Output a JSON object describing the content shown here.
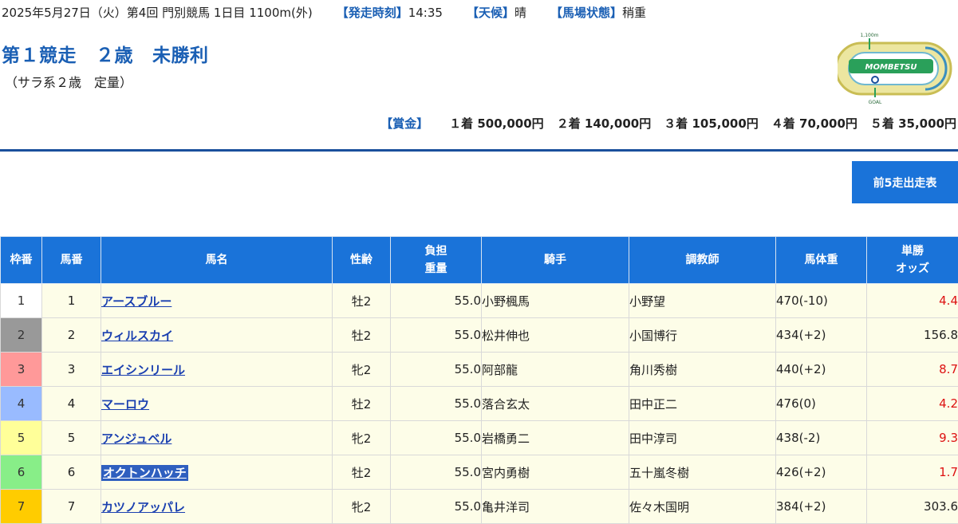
{
  "header": {
    "date_info": "2025年5月27日（火）第4回 門別競馬 1日目 1100m(外)",
    "start_time_label": "【発走時刻】",
    "start_time": "14:35",
    "weather_label": "【天候】",
    "weather": "晴",
    "track_label": "【馬場状態】",
    "track": "稍重"
  },
  "race": {
    "number": "第１競走",
    "age": "２歳",
    "class": "未勝利",
    "conditions": "（サラ系２歳　定量）"
  },
  "course_map": {
    "distance": "1,100m",
    "name": "MOMBETSU",
    "goal": "GOAL"
  },
  "prize": {
    "label": "【賞金】",
    "items": [
      "１着 500,000円",
      "２着 140,000円",
      "３着 105,000円",
      "４着 70,000円",
      "５着 35,000円"
    ]
  },
  "buttons": {
    "past5": "前5走出走表"
  },
  "table": {
    "headers": {
      "waku": "枠番",
      "umaban": "馬番",
      "name": "馬名",
      "sex_age": "性齢",
      "weight_1": "負担",
      "weight_2": "重量",
      "jockey": "騎手",
      "trainer": "調教師",
      "body_weight": "馬体重",
      "odds_1": "単勝",
      "odds_2": "オッズ"
    },
    "waku_colors": {
      "1": "#ffffff",
      "2": "#999999",
      "3": "#ff9999",
      "4": "#99bbff",
      "5": "#ffff99",
      "6": "#88ee88",
      "7": "#ffcc00"
    },
    "rows": [
      {
        "waku": "1",
        "umaban": "1",
        "name": "アースブルー",
        "sex_age": "牡2",
        "weight": "55.0",
        "jockey": "小野楓馬",
        "trainer": "小野望",
        "body_weight": "470(-10)",
        "odds": "4.4",
        "odds_red": true,
        "selected": false
      },
      {
        "waku": "2",
        "umaban": "2",
        "name": "ウィルスカイ",
        "sex_age": "牡2",
        "weight": "55.0",
        "jockey": "松井伸也",
        "trainer": "小国博行",
        "body_weight": "434(+2)",
        "odds": "156.8",
        "odds_red": false,
        "selected": false
      },
      {
        "waku": "3",
        "umaban": "3",
        "name": "エイシンリール",
        "sex_age": "牝2",
        "weight": "55.0",
        "jockey": "阿部龍",
        "trainer": "角川秀樹",
        "body_weight": "440(+2)",
        "odds": "8.7",
        "odds_red": true,
        "selected": false
      },
      {
        "waku": "4",
        "umaban": "4",
        "name": "マーロウ",
        "sex_age": "牡2",
        "weight": "55.0",
        "jockey": "落合玄太",
        "trainer": "田中正二",
        "body_weight": "476(0)",
        "odds": "4.2",
        "odds_red": true,
        "selected": false
      },
      {
        "waku": "5",
        "umaban": "5",
        "name": "アンジュベル",
        "sex_age": "牝2",
        "weight": "55.0",
        "jockey": "岩橋勇二",
        "trainer": "田中淳司",
        "body_weight": "438(-2)",
        "odds": "9.3",
        "odds_red": true,
        "selected": false
      },
      {
        "waku": "6",
        "umaban": "6",
        "name": "オクトンハッチ",
        "sex_age": "牡2",
        "weight": "55.0",
        "jockey": "宮内勇樹",
        "trainer": "五十嵐冬樹",
        "body_weight": "426(+2)",
        "odds": "1.7",
        "odds_red": true,
        "selected": true
      },
      {
        "waku": "7",
        "umaban": "7",
        "name": "カツノアッパレ",
        "sex_age": "牝2",
        "weight": "55.0",
        "jockey": "亀井洋司",
        "trainer": "佐々木国明",
        "body_weight": "384(+2)",
        "odds": "303.6",
        "odds_red": false,
        "selected": false
      }
    ]
  }
}
